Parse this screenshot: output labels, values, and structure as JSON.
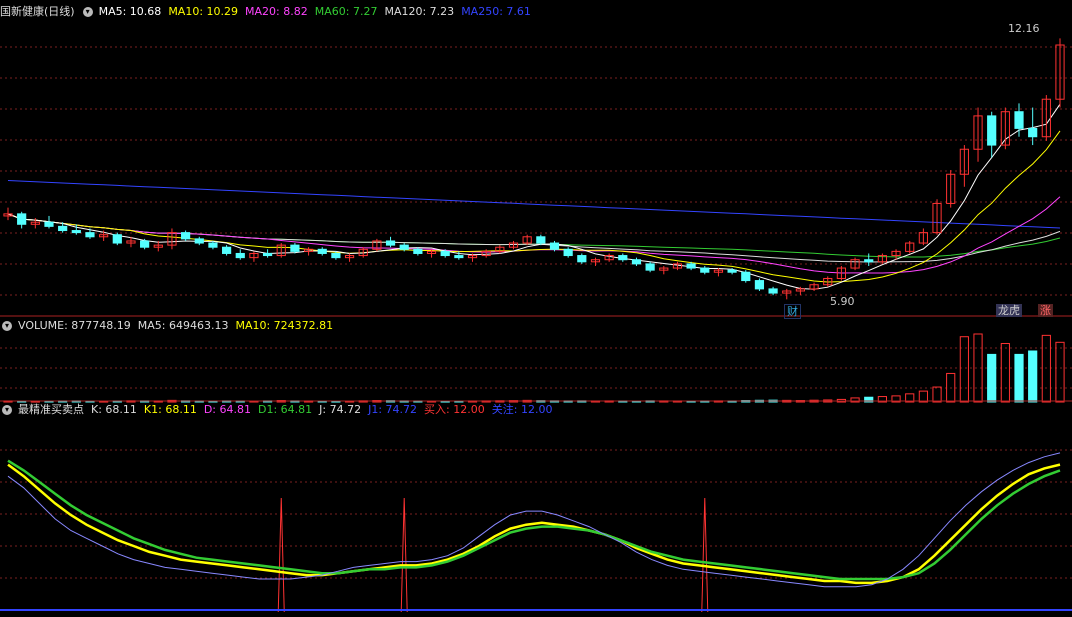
{
  "stock": {
    "name": "国新健康(日线)",
    "ma_labels": [
      {
        "text": "MA5: 10.68",
        "color": "#ffffff"
      },
      {
        "text": "MA10: 10.29",
        "color": "#ffff00"
      },
      {
        "text": "MA20: 8.82",
        "color": "#ff44ff"
      },
      {
        "text": "MA60: 7.27",
        "color": "#33cc33"
      },
      {
        "text": "MA120: 7.23",
        "color": "#dddddd"
      },
      {
        "text": "MA250: 7.61",
        "color": "#3344ff"
      }
    ]
  },
  "volume_header": [
    {
      "text": "VOLUME: 877748.19",
      "color": "#dddddd"
    },
    {
      "text": "MA5: 649463.13",
      "color": "#dddddd"
    },
    {
      "text": "MA10: 724372.81",
      "color": "#ffff00"
    }
  ],
  "indicator_header": [
    {
      "text": "最精准买卖点",
      "color": "#dddddd"
    },
    {
      "text": "K: 68.11",
      "color": "#dddddd"
    },
    {
      "text": "K1: 68.11",
      "color": "#ffff00"
    },
    {
      "text": "D: 64.81",
      "color": "#ff44ff"
    },
    {
      "text": "D1: 64.81",
      "color": "#33cc33"
    },
    {
      "text": "J: 74.72",
      "color": "#dddddd"
    },
    {
      "text": "J1: 74.72",
      "color": "#3344ff"
    },
    {
      "text": "买入: 12.00",
      "color": "#ff3333"
    },
    {
      "text": "关注: 12.00",
      "color": "#3344ff"
    }
  ],
  "annotations": {
    "high_label": "12.16",
    "low_label": "5.90",
    "tag_cai": "财",
    "tag_longhu": "龙虎",
    "tag_zhang": "涨"
  },
  "chart_data": [
    {
      "type": "candlestick",
      "title": "国新健康(日线)",
      "ylim": [
        5.5,
        12.6
      ],
      "annotations": {
        "high": 12.16,
        "low": 5.9
      },
      "ohlc_approx": [
        [
          7.9,
          8.1,
          7.8,
          7.95
        ],
        [
          7.95,
          8.0,
          7.6,
          7.7
        ],
        [
          7.7,
          7.85,
          7.6,
          7.75
        ],
        [
          7.75,
          7.9,
          7.6,
          7.65
        ],
        [
          7.65,
          7.75,
          7.5,
          7.55
        ],
        [
          7.55,
          7.7,
          7.45,
          7.5
        ],
        [
          7.5,
          7.6,
          7.35,
          7.4
        ],
        [
          7.4,
          7.55,
          7.3,
          7.45
        ],
        [
          7.45,
          7.5,
          7.2,
          7.25
        ],
        [
          7.25,
          7.4,
          7.15,
          7.3
        ],
        [
          7.3,
          7.35,
          7.1,
          7.15
        ],
        [
          7.15,
          7.3,
          7.05,
          7.2
        ],
        [
          7.2,
          7.6,
          7.1,
          7.5
        ],
        [
          7.5,
          7.55,
          7.3,
          7.35
        ],
        [
          7.35,
          7.4,
          7.2,
          7.25
        ],
        [
          7.25,
          7.3,
          7.1,
          7.15
        ],
        [
          7.15,
          7.2,
          6.95,
          7.0
        ],
        [
          7.0,
          7.1,
          6.85,
          6.9
        ],
        [
          6.9,
          7.05,
          6.8,
          7.0
        ],
        [
          7.0,
          7.1,
          6.9,
          6.95
        ],
        [
          6.95,
          7.25,
          6.9,
          7.2
        ],
        [
          7.2,
          7.25,
          7.0,
          7.05
        ],
        [
          7.05,
          7.15,
          6.95,
          7.1
        ],
        [
          7.1,
          7.15,
          6.95,
          7.0
        ],
        [
          7.0,
          7.05,
          6.85,
          6.9
        ],
        [
          6.9,
          7.0,
          6.8,
          6.95
        ],
        [
          6.95,
          7.15,
          6.9,
          7.1
        ],
        [
          7.1,
          7.35,
          7.05,
          7.3
        ],
        [
          7.3,
          7.4,
          7.15,
          7.2
        ],
        [
          7.2,
          7.25,
          7.05,
          7.1
        ],
        [
          7.1,
          7.15,
          6.95,
          7.0
        ],
        [
          7.0,
          7.1,
          6.9,
          7.05
        ],
        [
          7.05,
          7.1,
          6.9,
          6.95
        ],
        [
          6.95,
          7.05,
          6.85,
          6.9
        ],
        [
          6.9,
          7.0,
          6.8,
          6.95
        ],
        [
          6.95,
          7.1,
          6.9,
          7.05
        ],
        [
          7.05,
          7.2,
          7.0,
          7.15
        ],
        [
          7.15,
          7.3,
          7.1,
          7.25
        ],
        [
          7.25,
          7.45,
          7.2,
          7.4
        ],
        [
          7.4,
          7.45,
          7.2,
          7.25
        ],
        [
          7.25,
          7.3,
          7.05,
          7.1
        ],
        [
          7.1,
          7.15,
          6.9,
          6.95
        ],
        [
          6.95,
          7.0,
          6.75,
          6.8
        ],
        [
          6.8,
          6.9,
          6.7,
          6.85
        ],
        [
          6.85,
          7.0,
          6.8,
          6.95
        ],
        [
          6.95,
          7.0,
          6.8,
          6.85
        ],
        [
          6.85,
          6.9,
          6.7,
          6.75
        ],
        [
          6.75,
          6.8,
          6.55,
          6.6
        ],
        [
          6.6,
          6.7,
          6.5,
          6.65
        ],
        [
          6.65,
          6.8,
          6.6,
          6.75
        ],
        [
          6.75,
          6.8,
          6.6,
          6.65
        ],
        [
          6.65,
          6.7,
          6.5,
          6.55
        ],
        [
          6.55,
          6.65,
          6.45,
          6.6
        ],
        [
          6.6,
          6.65,
          6.5,
          6.55
        ],
        [
          6.55,
          6.6,
          6.3,
          6.35
        ],
        [
          6.35,
          6.4,
          6.1,
          6.15
        ],
        [
          6.15,
          6.2,
          6.0,
          6.05
        ],
        [
          6.05,
          6.15,
          5.9,
          6.1
        ],
        [
          6.1,
          6.2,
          6.0,
          6.15
        ],
        [
          6.15,
          6.3,
          6.1,
          6.25
        ],
        [
          6.25,
          6.45,
          6.2,
          6.4
        ],
        [
          6.4,
          6.7,
          6.35,
          6.65
        ],
        [
          6.65,
          6.9,
          6.6,
          6.85
        ],
        [
          6.85,
          7.0,
          6.7,
          6.8
        ],
        [
          6.8,
          7.0,
          6.75,
          6.95
        ],
        [
          6.95,
          7.1,
          6.85,
          7.05
        ],
        [
          7.05,
          7.3,
          7.0,
          7.25
        ],
        [
          7.25,
          7.6,
          7.2,
          7.5
        ],
        [
          7.5,
          8.3,
          7.45,
          8.2
        ],
        [
          8.2,
          9.0,
          8.1,
          8.9
        ],
        [
          8.9,
          9.6,
          8.6,
          9.5
        ],
        [
          9.5,
          10.5,
          9.2,
          10.3
        ],
        [
          10.3,
          10.4,
          9.3,
          9.6
        ],
        [
          9.6,
          10.5,
          9.5,
          10.4
        ],
        [
          10.4,
          10.6,
          9.8,
          10.0
        ],
        [
          10.0,
          10.5,
          9.6,
          9.8
        ],
        [
          9.8,
          10.8,
          9.7,
          10.7
        ],
        [
          10.7,
          12.16,
          10.5,
          12.0
        ]
      ]
    },
    {
      "type": "bar",
      "title": "VOLUME",
      "values_approx": [
        16000,
        15000,
        14000,
        15000,
        16000,
        17000,
        15000,
        14000,
        16000,
        18000,
        17000,
        16000,
        24000,
        18000,
        16000,
        15000,
        17000,
        16000,
        15000,
        17000,
        22000,
        17000,
        16000,
        15000,
        14000,
        15000,
        18000,
        22000,
        20000,
        17000,
        16000,
        15000,
        14000,
        15000,
        16000,
        17000,
        19000,
        21000,
        24000,
        20000,
        18000,
        17000,
        18000,
        16000,
        17000,
        16000,
        15000,
        18000,
        17000,
        16000,
        15000,
        16000,
        17000,
        16000,
        22000,
        25000,
        27000,
        24000,
        22000,
        26000,
        30000,
        38000,
        60000,
        70000,
        80000,
        90000,
        120000,
        160000,
        220000,
        420000,
        960000,
        1000000,
        700000,
        860000,
        700000,
        750000,
        980000,
        877748
      ]
    },
    {
      "type": "line",
      "title": "最精准买卖点",
      "ylim": [
        0,
        100
      ],
      "series": [
        {
          "name": "K",
          "color": "#ffff00",
          "values_approx": [
            76,
            70,
            63,
            56,
            50,
            45,
            41,
            37,
            34,
            31,
            29,
            27,
            26,
            25,
            24,
            23,
            22,
            21,
            20,
            19,
            19,
            20,
            21,
            22,
            23,
            24,
            24,
            25,
            27,
            30,
            34,
            39,
            43,
            45,
            46,
            45,
            44,
            42,
            40,
            37,
            33,
            30,
            27,
            25,
            24,
            23,
            22,
            21,
            20,
            19,
            18,
            17,
            16,
            16,
            15,
            15,
            16,
            18,
            22,
            29,
            37,
            45,
            53,
            60,
            66,
            71,
            74,
            76
          ]
        },
        {
          "name": "D",
          "color": "#33cc33",
          "values_approx": [
            78,
            73,
            67,
            61,
            55,
            50,
            46,
            42,
            38,
            35,
            32,
            30,
            28,
            27,
            26,
            25,
            24,
            23,
            22,
            21,
            20,
            20,
            21,
            22,
            22,
            23,
            23,
            24,
            26,
            29,
            33,
            37,
            41,
            43,
            44,
            44,
            43,
            42,
            40,
            37,
            34,
            31,
            29,
            27,
            26,
            25,
            24,
            23,
            22,
            21,
            20,
            19,
            18,
            17,
            17,
            17,
            17,
            18,
            20,
            25,
            32,
            40,
            48,
            55,
            61,
            66,
            70,
            73
          ]
        },
        {
          "name": "J",
          "color": "#8888ff",
          "values_approx": [
            70,
            64,
            56,
            48,
            42,
            38,
            34,
            30,
            27,
            25,
            23,
            22,
            21,
            20,
            19,
            18,
            17,
            17,
            17,
            18,
            19,
            21,
            23,
            24,
            25,
            26,
            26,
            27,
            29,
            33,
            39,
            45,
            50,
            52,
            52,
            50,
            47,
            44,
            40,
            36,
            31,
            27,
            24,
            22,
            21,
            20,
            19,
            18,
            17,
            16,
            15,
            14,
            13,
            13,
            13,
            14,
            17,
            22,
            29,
            38,
            47,
            55,
            62,
            68,
            73,
            77,
            80,
            82
          ]
        }
      ]
    }
  ]
}
